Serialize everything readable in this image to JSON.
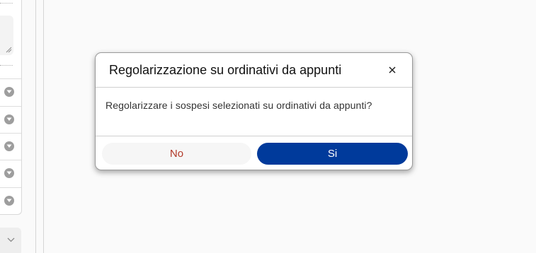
{
  "dialog": {
    "title": "Regolarizzazione su ordinativi da appunti",
    "message": "Regolarizzare i sospesi selezionati su ordinativi da appunti?",
    "buttons": {
      "no_label": "No",
      "yes_label": "Si"
    },
    "close_icon": "close-icon"
  },
  "left_panel": {
    "dropdown_icons": [
      "chevron-down-icon",
      "chevron-down-icon",
      "chevron-down-icon",
      "chevron-down-icon",
      "chevron-down-icon"
    ],
    "collapse_icon": "chevron-down-icon"
  },
  "colors": {
    "primary": "#003a9b",
    "danger_text": "#b23a2a",
    "background": "#fafafa"
  }
}
